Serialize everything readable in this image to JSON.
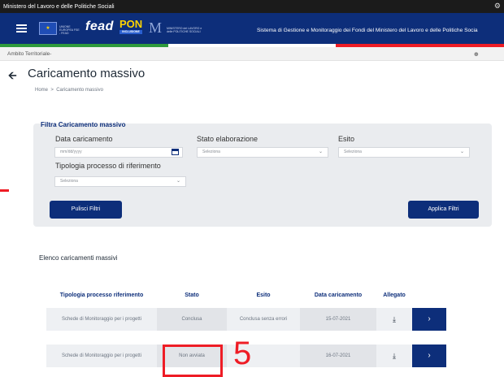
{
  "topbar": {
    "label": "Ministero del Lavoro e delle Politiche Sociali"
  },
  "header": {
    "fead": "fead",
    "pon": "PON",
    "pon_sub": "INCLUSIONE",
    "eu_text": "UNIONE EUROPEA FSE - FEAD",
    "ministry_text": "MINISTERO del LAVORO e delle POLITICHE SOCIALI",
    "system_title": "Sistema di Gestione e Monitoraggio dei Fondi del Ministero del Lavoro e delle Politiche Socia"
  },
  "ambito": {
    "label": "Ambito Territoriale-"
  },
  "page": {
    "title": "Caricamento massivo"
  },
  "breadcrumb": {
    "home": "Home",
    "sep": ">",
    "current": "Caricamento massivo"
  },
  "filter": {
    "legend": "Filtra Caricamento massivo",
    "data_label": "Data caricamento",
    "data_placeholder": "mm/dd/yyyy",
    "stato_label": "Stato elaborazione",
    "stato_value": "Seleziona",
    "esito_label": "Esito",
    "esito_value": "Seleziona",
    "tipologia_label": "Tipologia processo di riferimento",
    "tipologia_value": "Seleziona",
    "clear_label": "Pulisci Filtri",
    "apply_label": "Applica Filtri"
  },
  "list": {
    "title": "Elenco caricamenti massivi",
    "headers": [
      "Tipologia processo riferimento",
      "Stato",
      "Esito",
      "Data caricamento",
      "Allegato"
    ],
    "rows": [
      {
        "tipologia": "Schede di Monitoraggio per i progetti",
        "stato": "Conclusa",
        "esito": "Conclusa senza errori",
        "data": "15-07-2021"
      },
      {
        "tipologia": "Schede di Monitoraggio per i progetti",
        "stato": "Non avviata",
        "esito": "",
        "data": "16-07-2021"
      }
    ]
  },
  "annotation": {
    "number": "5"
  },
  "colors": {
    "navy": "#0d2e7a",
    "red": "#ee1c25",
    "green": "#2e9a3c"
  },
  "icons": {
    "download": "download-icon",
    "arrow": "chevron-right-icon",
    "back": "arrow-left-icon"
  }
}
